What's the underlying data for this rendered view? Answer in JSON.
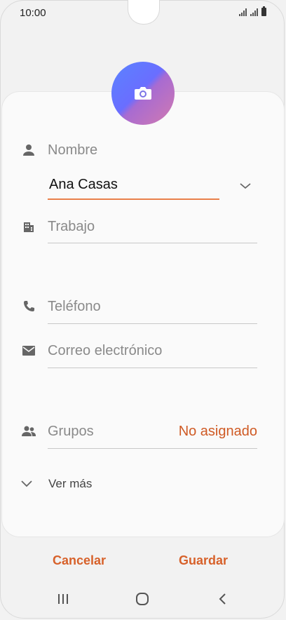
{
  "status_bar": {
    "time": "10:00"
  },
  "form": {
    "name_label": "Nombre",
    "name_value": "Ana Casas",
    "work_label": "Trabajo",
    "phone_label": "Teléfono",
    "email_label": "Correo electrónico",
    "groups_label": "Grupos",
    "groups_value": "No asignado",
    "more_label": "Ver más"
  },
  "actions": {
    "cancel": "Cancelar",
    "save": "Guardar"
  },
  "colors": {
    "accent": "#e9804a",
    "action_text": "#d7612a",
    "avatar_start": "#5a83ff",
    "avatar_end": "#d27ab0"
  },
  "icons": [
    "camera-icon",
    "person-icon",
    "building-icon",
    "phone-icon",
    "email-icon",
    "group-icon",
    "chevron-down-icon",
    "recent-apps-icon",
    "home-icon",
    "back-icon"
  ]
}
